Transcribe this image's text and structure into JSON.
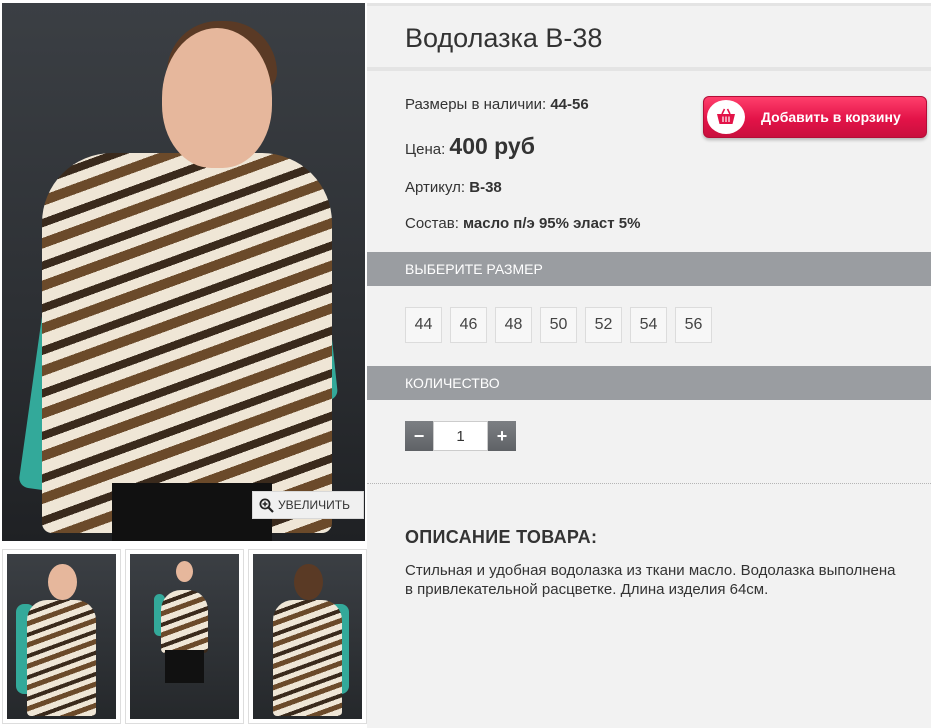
{
  "product": {
    "title": "Водолазка В-38",
    "sizes_available_label": "Размеры в наличии:",
    "sizes_available_value": "44-56",
    "price_label": "Цена:",
    "price_value": "400 руб",
    "article_label": "Артикул:",
    "article_value": "В-38",
    "composition_label": "Состав:",
    "composition_value": "масло п/э 95% эласт 5%"
  },
  "cart_button": {
    "label": "Добавить в корзину",
    "icon": "shopping-basket-icon",
    "color": "#e31348"
  },
  "gallery": {
    "zoom_label": "УВЕЛИЧИТЬ",
    "zoom_icon": "magnifier-plus-icon",
    "thumbnails": [
      "front",
      "full-length",
      "back"
    ]
  },
  "size_section": {
    "header": "ВЫБЕРИТЕ РАЗМЕР",
    "sizes": [
      "44",
      "46",
      "48",
      "50",
      "52",
      "54",
      "56"
    ]
  },
  "quantity_section": {
    "header": "КОЛИЧЕСТВО",
    "minus": "−",
    "plus": "+",
    "value": "1"
  },
  "description": {
    "title": "ОПИСАНИЕ ТОВАРА:",
    "text": "Стильная и удобная водолазка из ткани масло. Водолазка выполнена в привлекательной расцветке. Длина изделия 64см."
  },
  "colors": {
    "section_bar": "#9a9da1",
    "panel_bg": "#f2f2f2",
    "sleeve_teal": "#33a99a"
  }
}
